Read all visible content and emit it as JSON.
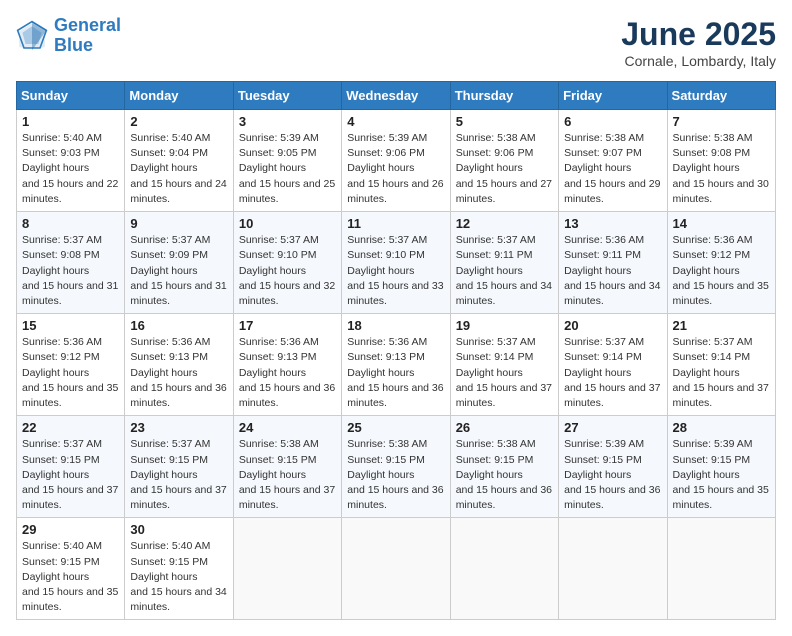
{
  "header": {
    "logo_line1": "General",
    "logo_line2": "Blue",
    "month": "June 2025",
    "location": "Cornale, Lombardy, Italy"
  },
  "columns": [
    "Sunday",
    "Monday",
    "Tuesday",
    "Wednesday",
    "Thursday",
    "Friday",
    "Saturday"
  ],
  "weeks": [
    [
      {
        "day": "1",
        "rise": "5:40 AM",
        "set": "9:03 PM",
        "daylight": "15 hours and 22 minutes."
      },
      {
        "day": "2",
        "rise": "5:40 AM",
        "set": "9:04 PM",
        "daylight": "15 hours and 24 minutes."
      },
      {
        "day": "3",
        "rise": "5:39 AM",
        "set": "9:05 PM",
        "daylight": "15 hours and 25 minutes."
      },
      {
        "day": "4",
        "rise": "5:39 AM",
        "set": "9:06 PM",
        "daylight": "15 hours and 26 minutes."
      },
      {
        "day": "5",
        "rise": "5:38 AM",
        "set": "9:06 PM",
        "daylight": "15 hours and 27 minutes."
      },
      {
        "day": "6",
        "rise": "5:38 AM",
        "set": "9:07 PM",
        "daylight": "15 hours and 29 minutes."
      },
      {
        "day": "7",
        "rise": "5:38 AM",
        "set": "9:08 PM",
        "daylight": "15 hours and 30 minutes."
      }
    ],
    [
      {
        "day": "8",
        "rise": "5:37 AM",
        "set": "9:08 PM",
        "daylight": "15 hours and 31 minutes."
      },
      {
        "day": "9",
        "rise": "5:37 AM",
        "set": "9:09 PM",
        "daylight": "15 hours and 31 minutes."
      },
      {
        "day": "10",
        "rise": "5:37 AM",
        "set": "9:10 PM",
        "daylight": "15 hours and 32 minutes."
      },
      {
        "day": "11",
        "rise": "5:37 AM",
        "set": "9:10 PM",
        "daylight": "15 hours and 33 minutes."
      },
      {
        "day": "12",
        "rise": "5:37 AM",
        "set": "9:11 PM",
        "daylight": "15 hours and 34 minutes."
      },
      {
        "day": "13",
        "rise": "5:36 AM",
        "set": "9:11 PM",
        "daylight": "15 hours and 34 minutes."
      },
      {
        "day": "14",
        "rise": "5:36 AM",
        "set": "9:12 PM",
        "daylight": "15 hours and 35 minutes."
      }
    ],
    [
      {
        "day": "15",
        "rise": "5:36 AM",
        "set": "9:12 PM",
        "daylight": "15 hours and 35 minutes."
      },
      {
        "day": "16",
        "rise": "5:36 AM",
        "set": "9:13 PM",
        "daylight": "15 hours and 36 minutes."
      },
      {
        "day": "17",
        "rise": "5:36 AM",
        "set": "9:13 PM",
        "daylight": "15 hours and 36 minutes."
      },
      {
        "day": "18",
        "rise": "5:36 AM",
        "set": "9:13 PM",
        "daylight": "15 hours and 36 minutes."
      },
      {
        "day": "19",
        "rise": "5:37 AM",
        "set": "9:14 PM",
        "daylight": "15 hours and 37 minutes."
      },
      {
        "day": "20",
        "rise": "5:37 AM",
        "set": "9:14 PM",
        "daylight": "15 hours and 37 minutes."
      },
      {
        "day": "21",
        "rise": "5:37 AM",
        "set": "9:14 PM",
        "daylight": "15 hours and 37 minutes."
      }
    ],
    [
      {
        "day": "22",
        "rise": "5:37 AM",
        "set": "9:15 PM",
        "daylight": "15 hours and 37 minutes."
      },
      {
        "day": "23",
        "rise": "5:37 AM",
        "set": "9:15 PM",
        "daylight": "15 hours and 37 minutes."
      },
      {
        "day": "24",
        "rise": "5:38 AM",
        "set": "9:15 PM",
        "daylight": "15 hours and 37 minutes."
      },
      {
        "day": "25",
        "rise": "5:38 AM",
        "set": "9:15 PM",
        "daylight": "15 hours and 36 minutes."
      },
      {
        "day": "26",
        "rise": "5:38 AM",
        "set": "9:15 PM",
        "daylight": "15 hours and 36 minutes."
      },
      {
        "day": "27",
        "rise": "5:39 AM",
        "set": "9:15 PM",
        "daylight": "15 hours and 36 minutes."
      },
      {
        "day": "28",
        "rise": "5:39 AM",
        "set": "9:15 PM",
        "daylight": "15 hours and 35 minutes."
      }
    ],
    [
      {
        "day": "29",
        "rise": "5:40 AM",
        "set": "9:15 PM",
        "daylight": "15 hours and 35 minutes."
      },
      {
        "day": "30",
        "rise": "5:40 AM",
        "set": "9:15 PM",
        "daylight": "15 hours and 34 minutes."
      },
      null,
      null,
      null,
      null,
      null
    ]
  ]
}
